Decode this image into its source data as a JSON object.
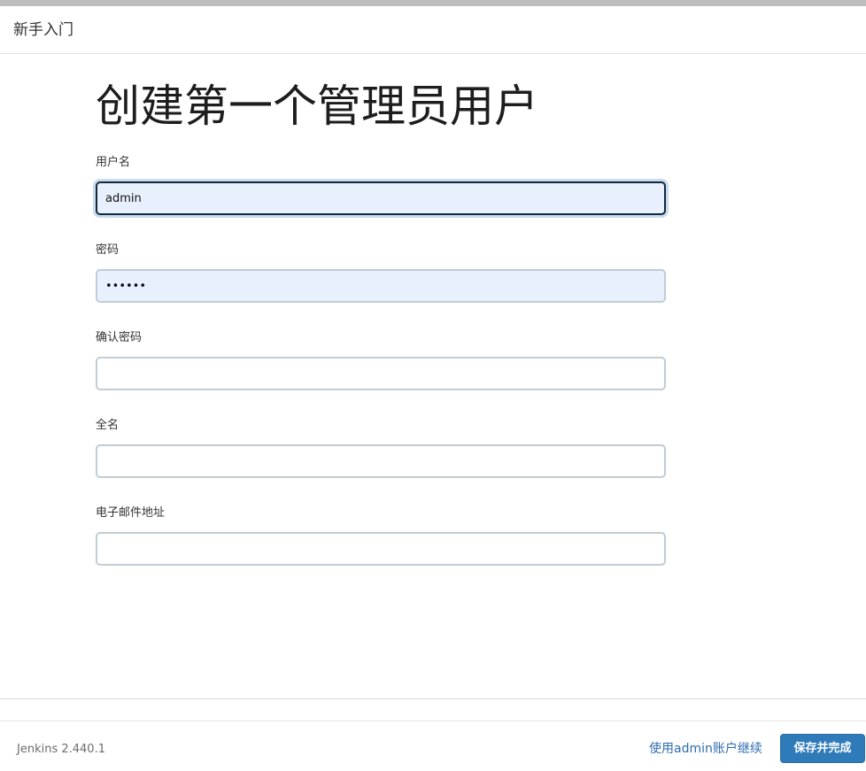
{
  "header": {
    "title": "新手入门"
  },
  "page": {
    "title": "创建第一个管理员用户"
  },
  "form": {
    "username": {
      "label": "用户名",
      "value": "admin"
    },
    "password": {
      "label": "密码",
      "value": "••••••"
    },
    "confirm_password": {
      "label": "确认密码",
      "value": ""
    },
    "fullname": {
      "label": "全名",
      "value": ""
    },
    "email": {
      "label": "电子邮件地址",
      "value": ""
    }
  },
  "footer": {
    "version": "Jenkins 2.440.1",
    "continue_link": "使用admin账户继续",
    "save_button": "保存并完成"
  },
  "colors": {
    "primary_button": "#2f7ab8",
    "link": "#2d6cb1",
    "autofill_background": "#e8f0fe",
    "focus_border": "#13283a"
  }
}
